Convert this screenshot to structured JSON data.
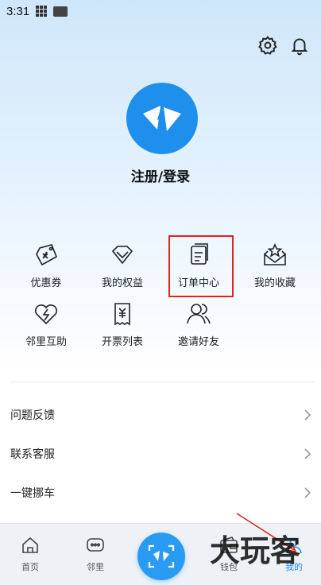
{
  "status_bar": {
    "time": "3:31"
  },
  "header": {
    "icons": [
      "gear-icon",
      "bell-icon"
    ]
  },
  "profile": {
    "login_label": "注册/登录"
  },
  "services": [
    {
      "label": "优惠券",
      "icon": "coupon-icon"
    },
    {
      "label": "我的权益",
      "icon": "diamond-icon"
    },
    {
      "label": "订单中心",
      "icon": "order-icon",
      "highlighted": true
    },
    {
      "label": "我的收藏",
      "icon": "favorites-icon"
    },
    {
      "label": "邻里互助",
      "icon": "heart-help-icon"
    },
    {
      "label": "开票列表",
      "icon": "invoice-icon"
    },
    {
      "label": "邀请好友",
      "icon": "invite-friend-icon"
    }
  ],
  "list": [
    {
      "label": "问题反馈"
    },
    {
      "label": "联系客服"
    },
    {
      "label": "一键挪车"
    }
  ],
  "tabbar": {
    "tabs": [
      {
        "label": "首页",
        "icon": "home-icon"
      },
      {
        "label": "邻里",
        "icon": "chat-icon"
      },
      {
        "label": "钱包",
        "icon": "wallet-icon"
      },
      {
        "label": "我的",
        "icon": "profile-icon",
        "active": true
      }
    ],
    "center_icon": "scan-icon"
  },
  "watermark": {
    "text": "大玩客"
  },
  "colors": {
    "brand": "#1f8fee",
    "highlight": "#e2231a"
  }
}
